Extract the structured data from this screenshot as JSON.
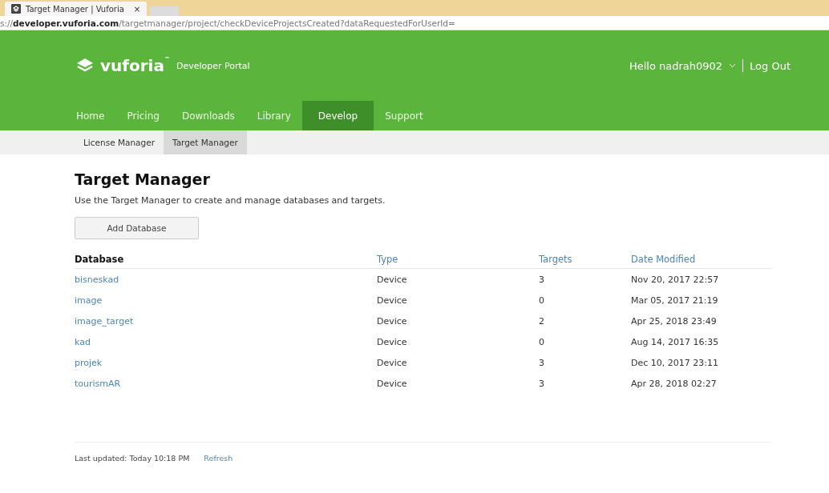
{
  "browser": {
    "tab_title": "Target Manager | Vuforia",
    "tab_close": "×",
    "url": "s://**developer.vuforia.com**/targetmanager/project/checkDeviceProjectsCreated?dataRequestedForUserId="
  },
  "header": {
    "logo_text": "vuforia",
    "logo_tm": "™",
    "portal": "Developer Portal",
    "user": "Hello nadrah0902",
    "logout": "Log Out"
  },
  "nav": [
    {
      "label": "Home",
      "selected": false
    },
    {
      "label": "Pricing",
      "selected": false
    },
    {
      "label": "Downloads",
      "selected": false
    },
    {
      "label": "Library",
      "selected": false
    },
    {
      "label": "Develop",
      "selected": true
    },
    {
      "label": "Support",
      "selected": false
    }
  ],
  "subnav": [
    {
      "label": "License Manager",
      "selected": false
    },
    {
      "label": "Target Manager",
      "selected": true
    }
  ],
  "page": {
    "title": "Target Manager",
    "description": "Use the Target Manager to create and manage databases and targets.",
    "add_button": "Add Database"
  },
  "table": {
    "columns": [
      "Database",
      "Type",
      "Targets",
      "Date Modified"
    ],
    "rows": [
      {
        "database": "bisneskad",
        "type": "Device",
        "targets": "3",
        "date": "Nov 20, 2017 22:57"
      },
      {
        "database": "image",
        "type": "Device",
        "targets": "0",
        "date": "Mar 05, 2017 21:19"
      },
      {
        "database": "image_target",
        "type": "Device",
        "targets": "2",
        "date": "Apr 25, 2018 23:49"
      },
      {
        "database": "kad",
        "type": "Device",
        "targets": "0",
        "date": "Aug 14, 2017 16:35"
      },
      {
        "database": "projek",
        "type": "Device",
        "targets": "3",
        "date": "Dec 10, 2017 23:11"
      },
      {
        "database": "tourismAR",
        "type": "Device",
        "targets": "3",
        "date": "Apr 28, 2018 02:27"
      }
    ]
  },
  "footer": {
    "last_updated": "Last updated: Today 10:18 PM",
    "refresh": "Refresh"
  }
}
